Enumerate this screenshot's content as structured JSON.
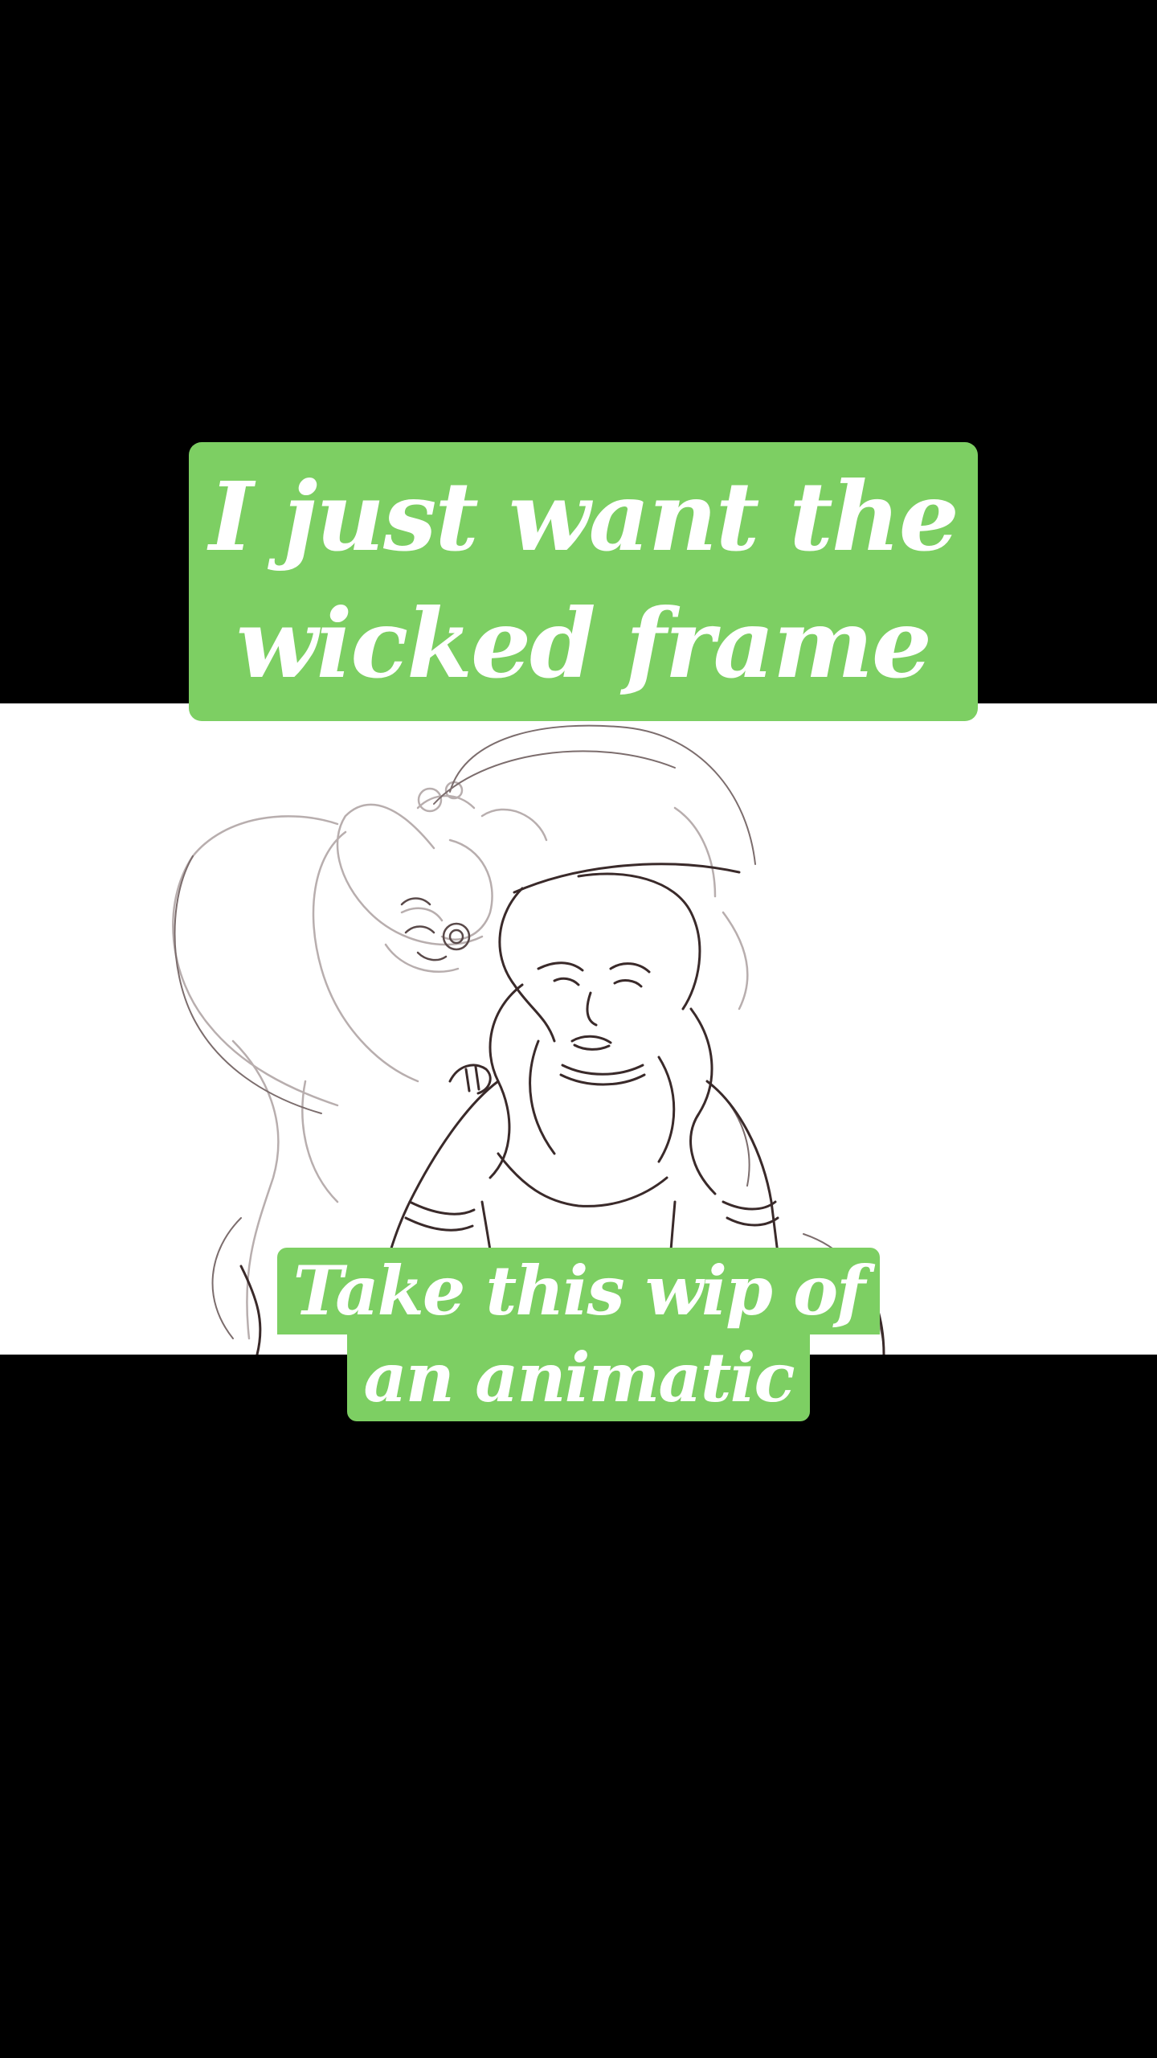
{
  "caption_top": {
    "line1": "I just want the",
    "line2": "wicked frame"
  },
  "caption_bottom": {
    "line1": "Take this wip of",
    "line2": "an animatic"
  },
  "colors": {
    "caption_bg": "#7dcf63",
    "caption_text": "#ffffff",
    "letterbox": "#000000",
    "frame_bg": "#ffffff",
    "sketch_line": "#3a2a2a",
    "sketch_faint": "#b8aeae"
  },
  "artwork": {
    "icon": "sketch-illustration"
  }
}
